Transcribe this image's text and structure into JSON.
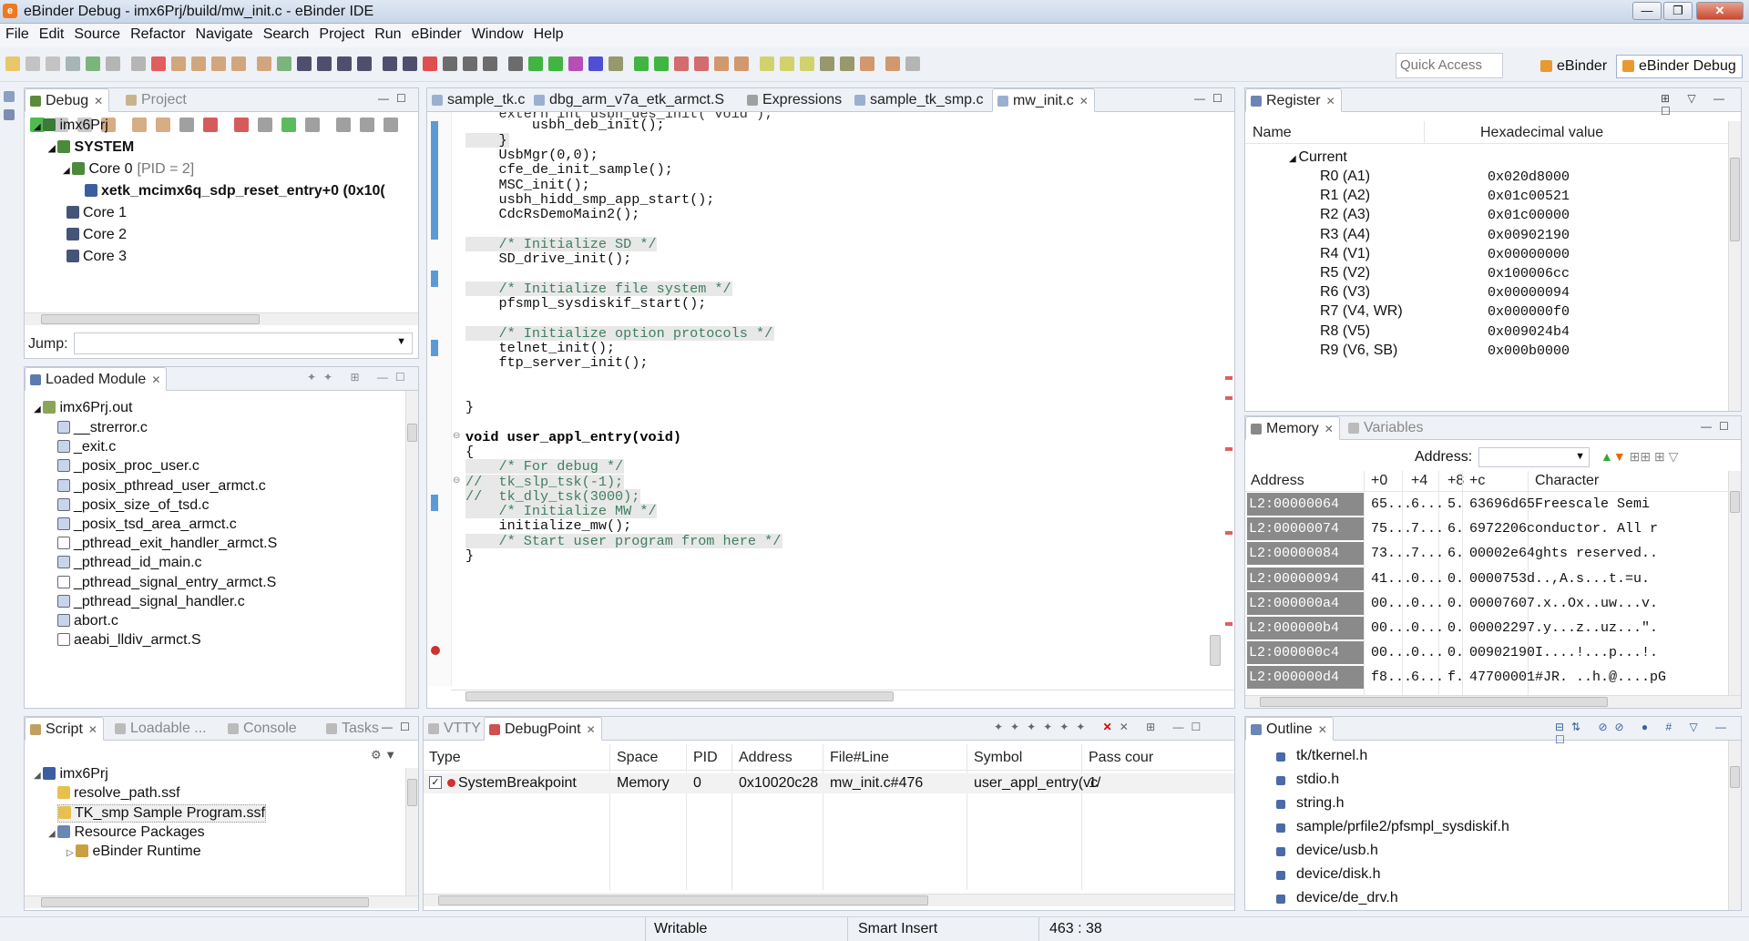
{
  "window": {
    "title": "eBinder Debug - imx6Prj/build/mw_init.c - eBinder IDE"
  },
  "menu": [
    "File",
    "Edit",
    "Source",
    "Refactor",
    "Navigate",
    "Search",
    "Project",
    "Run",
    "eBinder",
    "Window",
    "Help"
  ],
  "quick_access": {
    "placeholder": "Quick Access"
  },
  "perspectives": [
    "eBinder",
    "eBinder Debug"
  ],
  "debug_view": {
    "tabs": [
      "Debug",
      "Project"
    ],
    "tree": [
      {
        "label": "imx6Prj",
        "level": 0
      },
      {
        "label": "SYSTEM",
        "level": 1
      },
      {
        "label": "Core 0",
        "suffix": "[PID = 2]",
        "level": 2
      },
      {
        "label": "xetk_mcimx6q_sdp_reset_entry+0 (0x10(",
        "level": 3
      },
      {
        "label": "Core 1",
        "level": 2
      },
      {
        "label": "Core 2",
        "level": 2
      },
      {
        "label": "Core 3",
        "level": 2
      }
    ],
    "jump_label": "Jump:"
  },
  "loaded_module": {
    "title": "Loaded Module",
    "root": "imx6Prj.out",
    "files": [
      "__strerror.c",
      "_exit.c",
      "_posix_proc_user.c",
      "_posix_pthread_user_armct.c",
      "_posix_size_of_tsd.c",
      "_posix_tsd_area_armct.c",
      "_pthread_exit_handler_armct.S",
      "_pthread_id_main.c",
      "_pthread_signal_entry_armct.S",
      "_pthread_signal_handler.c",
      "abort.c",
      "aeabi_lldiv_armct.S"
    ]
  },
  "editor": {
    "tabs": [
      "sample_tk.c",
      "dbg_arm_v7a_etk_armct.S",
      "Expressions",
      "sample_tk_smp.c",
      "mw_init.c"
    ],
    "lines": [
      {
        "t": "    extern int usbh_des_init( void );",
        "c": "code"
      },
      {
        "t": "        usbh_deb_init();",
        "c": "code"
      },
      {
        "t": "    }",
        "c": "hl"
      },
      {
        "t": "    UsbMgr(0,0);",
        "c": "code"
      },
      {
        "t": "    cfe_de_init_sample();",
        "c": "code"
      },
      {
        "t": "    MSC_init();",
        "c": "code"
      },
      {
        "t": "    usbh_hidd_smp_app_start();",
        "c": "code"
      },
      {
        "t": "    CdcRsDemoMain2();",
        "c": "code"
      },
      {
        "t": "",
        "c": "code"
      },
      {
        "t": "    /* Initialize SD */",
        "c": "cmt"
      },
      {
        "t": "    SD_drive_init();",
        "c": "code"
      },
      {
        "t": "",
        "c": "code"
      },
      {
        "t": "    /* Initialize file system */",
        "c": "cmt"
      },
      {
        "t": "    pfsmpl_sysdiskif_start();",
        "c": "code"
      },
      {
        "t": "",
        "c": "code"
      },
      {
        "t": "    /* Initialize option protocols */",
        "c": "cmt"
      },
      {
        "t": "    telnet_init();",
        "c": "code"
      },
      {
        "t": "    ftp_server_init();",
        "c": "code"
      },
      {
        "t": "",
        "c": "code"
      },
      {
        "t": "",
        "c": "code"
      },
      {
        "t": "}",
        "c": "code"
      },
      {
        "t": "",
        "c": "code"
      },
      {
        "t": "void user_appl_entry(void)",
        "c": "kw"
      },
      {
        "t": "{",
        "c": "code"
      },
      {
        "t": "    /* For debug */",
        "c": "cmt"
      },
      {
        "t": "//  tk_slp_tsk(-1);",
        "c": "cmt"
      },
      {
        "t": "//  tk_dly_tsk(3000);",
        "c": "cmt"
      },
      {
        "t": "    /* Initialize MW */",
        "c": "cmt"
      },
      {
        "t": "    initialize_mw();",
        "c": "code"
      },
      {
        "t": "    /* Start user program from here */",
        "c": "cmt"
      },
      {
        "t": "}",
        "c": "code"
      }
    ]
  },
  "register": {
    "title": "Register",
    "col_name": "Name",
    "col_value": "Hexadecimal value",
    "group": "Current",
    "rows": [
      [
        "R0 (A1)",
        "0x020d8000"
      ],
      [
        "R1 (A2)",
        "0x01c00521"
      ],
      [
        "R2 (A3)",
        "0x01c00000"
      ],
      [
        "R3 (A4)",
        "0x00902190"
      ],
      [
        "R4 (V1)",
        "0x00000000"
      ],
      [
        "R5 (V2)",
        "0x100006cc"
      ],
      [
        "R6 (V3)",
        "0x00000094"
      ],
      [
        "R7 (V4, WR)",
        "0x000000f0"
      ],
      [
        "R8 (V5)",
        "0x009024b4"
      ],
      [
        "R9 (V6, SB)",
        "0x000b0000"
      ]
    ]
  },
  "memory": {
    "tabs": [
      "Memory",
      "Variables"
    ],
    "address_label": "Address:",
    "cols": [
      "Address",
      "+0",
      "+4",
      "+8",
      "+c",
      "Character"
    ],
    "rows": [
      [
        "L2:00000064",
        "65...",
        "6...",
        "5.",
        "63696d65",
        "Freescale Semi"
      ],
      [
        "L2:00000074",
        "75...",
        "7...",
        "6.",
        "6972206c",
        "onductor. All r"
      ],
      [
        "L2:00000084",
        "73...",
        "7...",
        "6.",
        "00002e64",
        "ghts reserved.."
      ],
      [
        "L2:00000094",
        "41...",
        "0...",
        "0.",
        "0000753d",
        "..,A.s...t.=u."
      ],
      [
        "L2:000000a4",
        "00...",
        "0...",
        "0.",
        "00007607",
        ".x..Ox..uw...v."
      ],
      [
        "L2:000000b4",
        "00...",
        "0...",
        "0.",
        "00002297",
        ".y...z..uz...\"."
      ],
      [
        "L2:000000c4",
        "00...",
        "0...",
        "0.",
        "00902190",
        "I....!...p...!."
      ],
      [
        "L2:000000d4",
        "f8...",
        "6...",
        "f.",
        "47700001",
        "#JR. ..h.@....pG"
      ]
    ]
  },
  "script": {
    "tabs": [
      "Script",
      "Loadable ...",
      "Console",
      "Tasks"
    ],
    "tree": [
      {
        "label": "imx6Prj",
        "level": 0
      },
      {
        "label": "resolve_path.ssf",
        "level": 1
      },
      {
        "label": "TK_smp Sample Program.ssf",
        "level": 1
      },
      {
        "label": "Resource Packages",
        "level": 1
      },
      {
        "label": "eBinder Runtime",
        "level": 2
      }
    ]
  },
  "debugpoint": {
    "tabs": [
      "VTTY",
      "DebugPoint"
    ],
    "cols": [
      "Type",
      "Space",
      "PID",
      "Address",
      "File#Line",
      "Symbol",
      "Pass cour"
    ],
    "rows": [
      [
        "SystemBreakpoint",
        "Memory",
        "0",
        "0x10020c28",
        "mw_init.c#476",
        "user_appl_entry(vc",
        "1/"
      ]
    ]
  },
  "outline": {
    "title": "Outline",
    "items": [
      "tk/tkernel.h",
      "stdio.h",
      "string.h",
      "sample/prfile2/pfsmpl_sysdiskif.h",
      "device/usb.h",
      "device/disk.h",
      "device/de_drv.h"
    ]
  },
  "status": {
    "writable": "Writable",
    "insert": "Smart Insert",
    "position": "463 : 38"
  }
}
